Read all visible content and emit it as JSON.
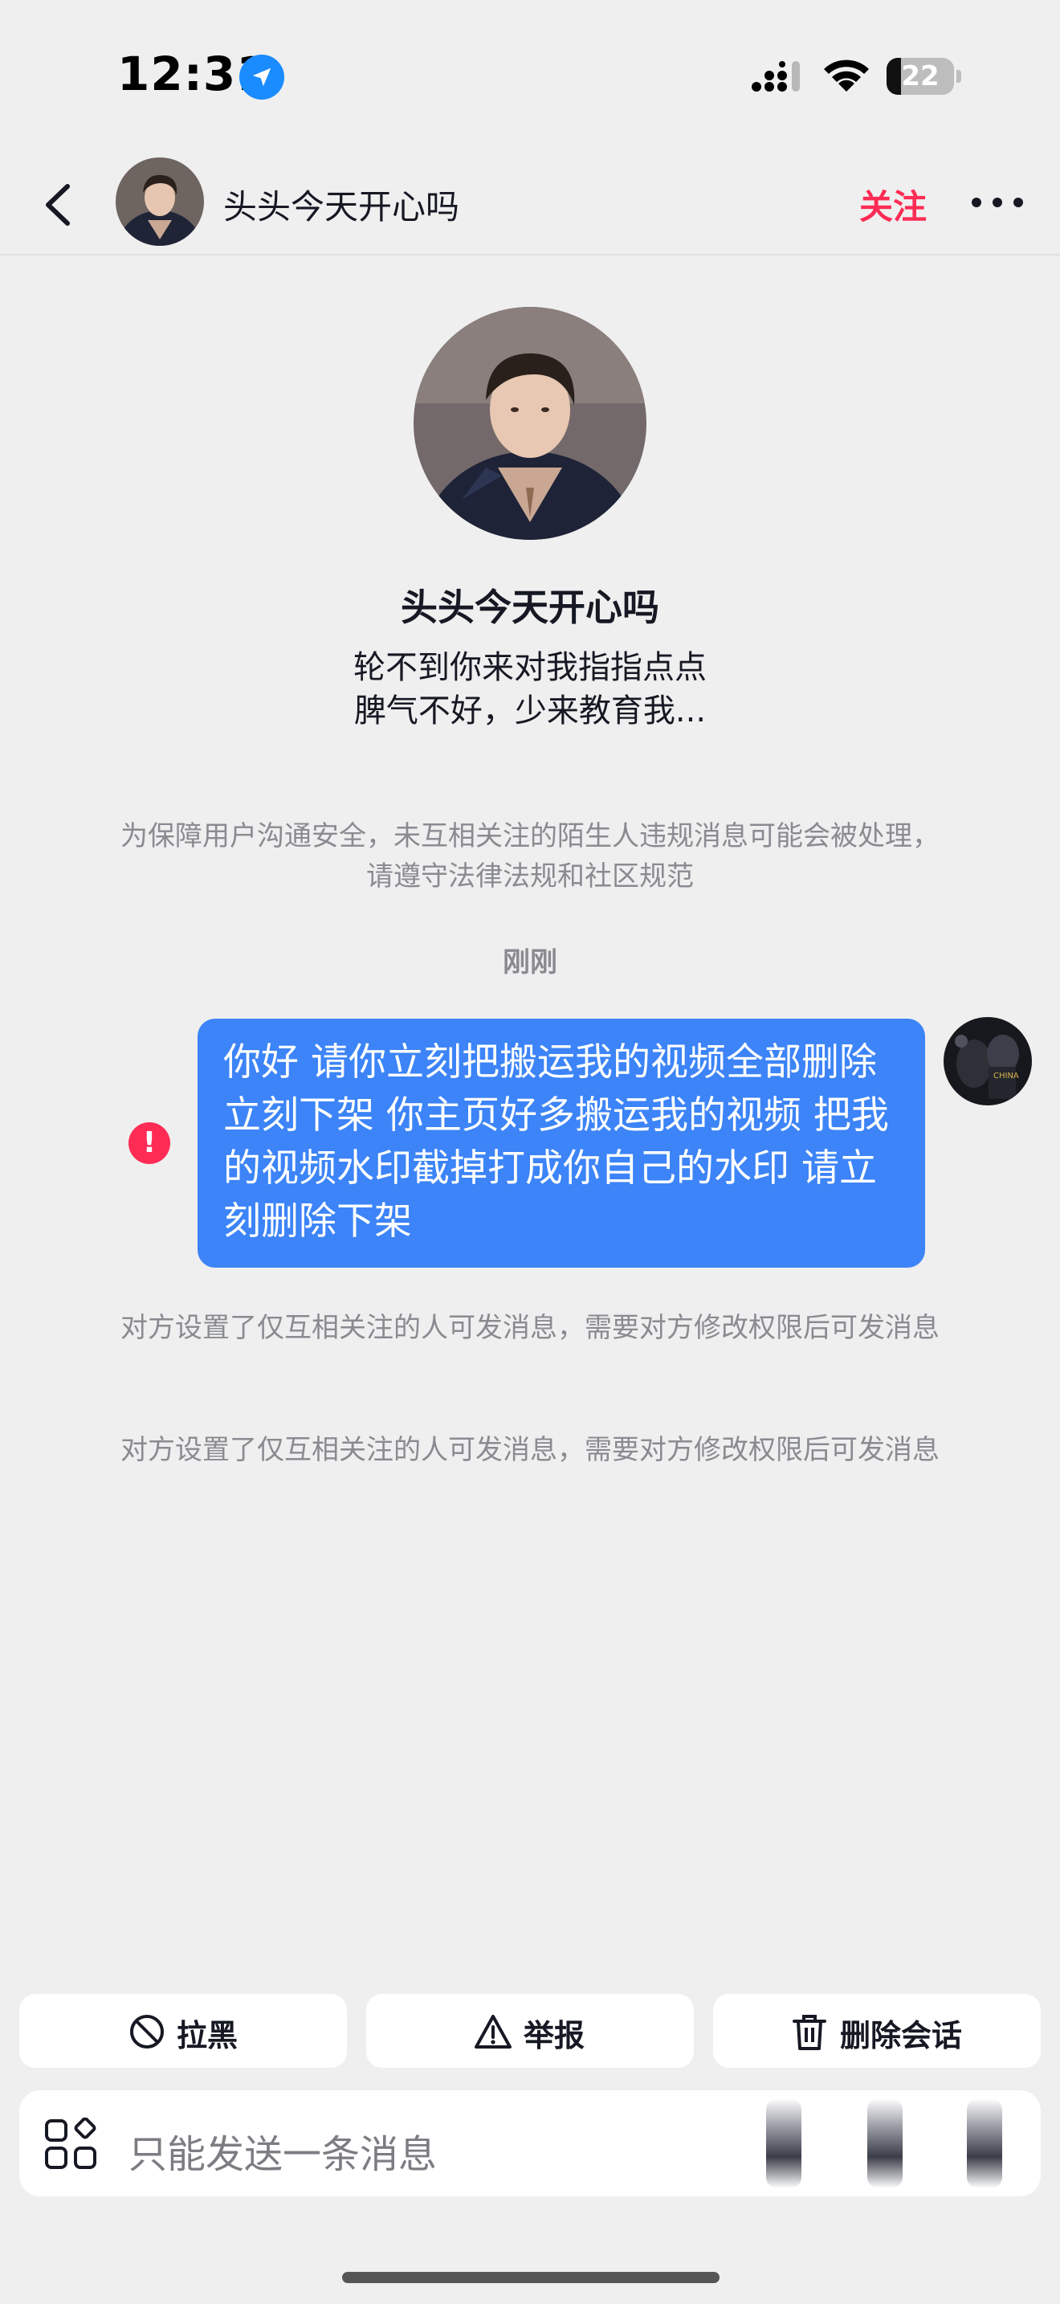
{
  "status_bar": {
    "time": "12:31",
    "battery_level": "22",
    "battery_fraction": 0.22
  },
  "header": {
    "username": "头头今天开心吗",
    "follow_label": "关注"
  },
  "profile": {
    "name": "头头今天开心吗",
    "bio_line1": "轮不到你来对我指指点点",
    "bio_line2": "脾气不好，少来教育我..."
  },
  "notices": {
    "safety": "为保障用户沟通安全，未互相关注的陌生人违规消息可能会被处理，请遵守法律法规和社区规范",
    "timestamp": "刚刚",
    "permission_1": "对方设置了仅互相关注的人可发消息，需要对方修改权限后可发消息",
    "permission_2": "对方设置了仅互相关注的人可发消息，需要对方修改权限后可发消息"
  },
  "message": {
    "text": "你好 请你立刻把搬运我的视频全部删除立刻下架 你主页好多搬运我的视频 把我的视频水印截掉打成你自己的水印 请立刻删除下架",
    "status": "error"
  },
  "actions": {
    "block_label": "拉黑",
    "report_label": "举报",
    "delete_label": "删除会话"
  },
  "input": {
    "placeholder": "只能发送一条消息"
  },
  "colors": {
    "accent_pink": "#fe2c55",
    "bubble_blue": "#3c84f7",
    "background": "#efefef",
    "location_blue": "#1a8cff"
  },
  "icons": [
    "location-arrow-icon",
    "signal-icon",
    "wifi-icon",
    "battery-icon",
    "back-arrow-icon",
    "more-dots-icon",
    "error-icon",
    "block-icon",
    "warning-triangle-icon",
    "trash-icon",
    "apps-grid-icon"
  ]
}
